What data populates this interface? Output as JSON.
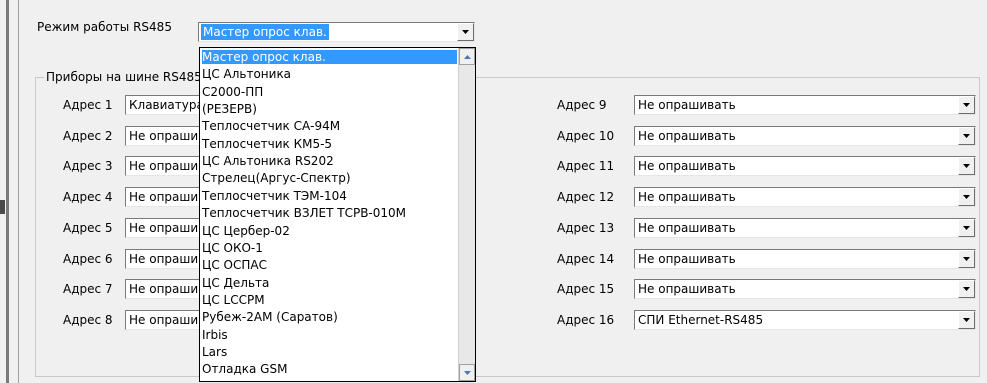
{
  "mode": {
    "label": "Режим работы RS485",
    "value": "Мастер опрос клав."
  },
  "group_title": "Приборы на шине RS485",
  "left_addresses": [
    {
      "label": "Адрес 1",
      "value": "Клавиатура"
    },
    {
      "label": "Адрес 2",
      "value": "Не опрашивать"
    },
    {
      "label": "Адрес 3",
      "value": "Не опрашивать"
    },
    {
      "label": "Адрес 4",
      "value": "Не опрашивать"
    },
    {
      "label": "Адрес 5",
      "value": "Не опрашивать"
    },
    {
      "label": "Адрес 6",
      "value": "Не опрашивать"
    },
    {
      "label": "Адрес 7",
      "value": "Не опрашивать"
    },
    {
      "label": "Адрес 8",
      "value": "Не опрашивать"
    }
  ],
  "right_addresses": [
    {
      "label": "Адрес 9",
      "value": "Не опрашивать"
    },
    {
      "label": "Адрес 10",
      "value": "Не опрашивать"
    },
    {
      "label": "Адрес 11",
      "value": "Не опрашивать"
    },
    {
      "label": "Адрес 12",
      "value": "Не опрашивать"
    },
    {
      "label": "Адрес 13",
      "value": "Не опрашивать"
    },
    {
      "label": "Адрес 14",
      "value": "Не опрашивать"
    },
    {
      "label": "Адрес 15",
      "value": "Не опрашивать"
    },
    {
      "label": "Адрес 16",
      "value": "СПИ Ethernet-RS485"
    }
  ],
  "dropdown_options": [
    "Мастер опрос клав.",
    "ЦС Альтоника",
    "С2000-ПП",
    "(РЕЗЕРВ)",
    "Теплосчетчик СА-94М",
    "Теплосчетчик КМ5-5",
    "ЦС Альтоника RS202",
    "Стрелец(Аргус-Спектр)",
    "Теплосчетчик ТЭМ-104",
    "Теплосчетчик ВЗЛЕТ ТСРВ-010М",
    "ЦС Цербер-02",
    "ЦС ОКО-1",
    "ЦС ОСПАС",
    "ЦС Дельта",
    "ЦС LCCPM",
    "Рубеж-2АМ (Саратов)",
    "Irbis",
    "Lars",
    "Отладка GSM"
  ],
  "dropdown_selected_index": 0,
  "icons": {
    "combo_button": "chevron-down-icon",
    "scroll_up": "scroll-up-arrow-icon",
    "scroll_down": "scroll-down-arrow-icon"
  },
  "colors": {
    "selection": "#3399ff",
    "background": "#f0f0f0"
  }
}
